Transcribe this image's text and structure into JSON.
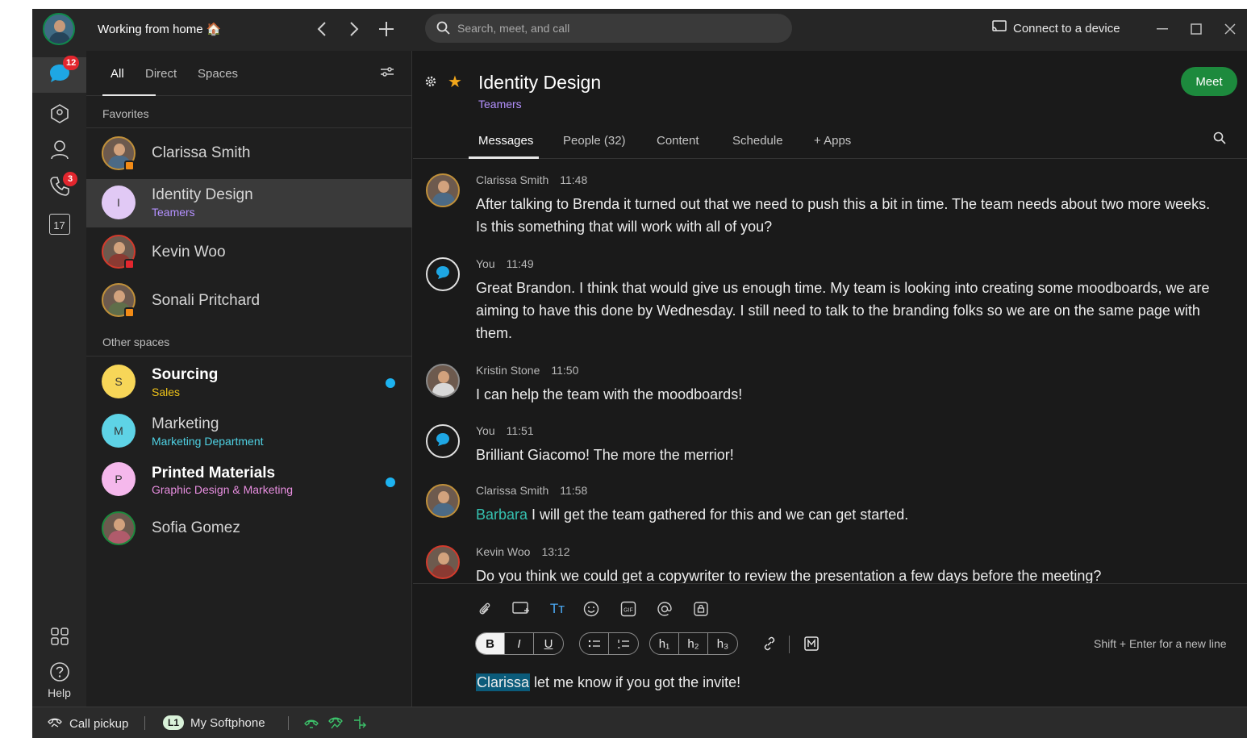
{
  "titlebar": {
    "status_text": "Working from home 🏠",
    "search_placeholder": "Search, meet, and call",
    "connect_label": "Connect to a device"
  },
  "rail": {
    "messages_badge": "12",
    "calls_badge": "3",
    "calendar_day": "17",
    "help_label": "Help"
  },
  "list": {
    "filter_tabs": [
      "All",
      "Direct",
      "Spaces"
    ],
    "favorites_label": "Favorites",
    "other_label": "Other spaces",
    "favorites": [
      {
        "name": "Clarissa Smith",
        "sub": ""
      },
      {
        "name": "Identity Design",
        "sub": "Teamers",
        "initial": "I"
      },
      {
        "name": "Kevin Woo",
        "sub": ""
      },
      {
        "name": "Sonali Pritchard",
        "sub": ""
      }
    ],
    "others": [
      {
        "name": "Sourcing",
        "sub": "Sales",
        "initial": "S",
        "unread": true
      },
      {
        "name": "Marketing",
        "sub": "Marketing Department",
        "initial": "M",
        "unread": false
      },
      {
        "name": "Printed Materials",
        "sub": "Graphic Design & Marketing",
        "initial": "P",
        "unread": true
      },
      {
        "name": "Sofia Gomez",
        "sub": "",
        "unread": false
      }
    ]
  },
  "space": {
    "title": "Identity Design",
    "team": "Teamers",
    "meet_label": "Meet",
    "tabs": [
      "Messages",
      "People (32)",
      "Content",
      "Schedule",
      "+ Apps"
    ]
  },
  "messages": [
    {
      "author": "Clarissa Smith",
      "time": "11:48",
      "text": "After talking to Brenda it turned out that we need to push this a bit in time. The team needs about two more weeks. Is this something that will work with all of you?"
    },
    {
      "author": "You",
      "time": "11:49",
      "text": "Great Brandon. I think that would give us enough time. My team is looking into creating some moodboards, we are aiming to have this done by Wednesday. I still need to talk to the branding folks so we are on the same page with them."
    },
    {
      "author": "Kristin Stone",
      "time": "11:50",
      "text": "I can help the team with the moodboards!"
    },
    {
      "author": "You",
      "time": "11:51",
      "text": "Brilliant Giacomo! The more the merrior!"
    },
    {
      "author": "Clarissa Smith",
      "time": "11:58",
      "mention": "Barbara",
      "text": " I will get the team gathered for this and we can get started."
    },
    {
      "author": "Kevin Woo",
      "time": "13:12",
      "text": "Do you think we could get a copywriter to review the presentation a few days before the meeting?"
    }
  ],
  "composer": {
    "format_buttons": [
      "B",
      "I",
      "U",
      "h₁",
      "h₂",
      "h₃"
    ],
    "hint": "Shift + Enter for a new line",
    "draft_mention": "Clarissa",
    "draft_text": " let me know if you got the invite!"
  },
  "bottombar": {
    "call_pickup": "Call pickup",
    "line_badge": "L1",
    "softphone": "My Softphone"
  },
  "colors": {
    "accent_green": "#1d8a3d",
    "mention_teal": "#35c1b0",
    "team_purple": "#b491ff",
    "unread_blue": "#1db3f0",
    "badge_red": "#e3262e"
  }
}
